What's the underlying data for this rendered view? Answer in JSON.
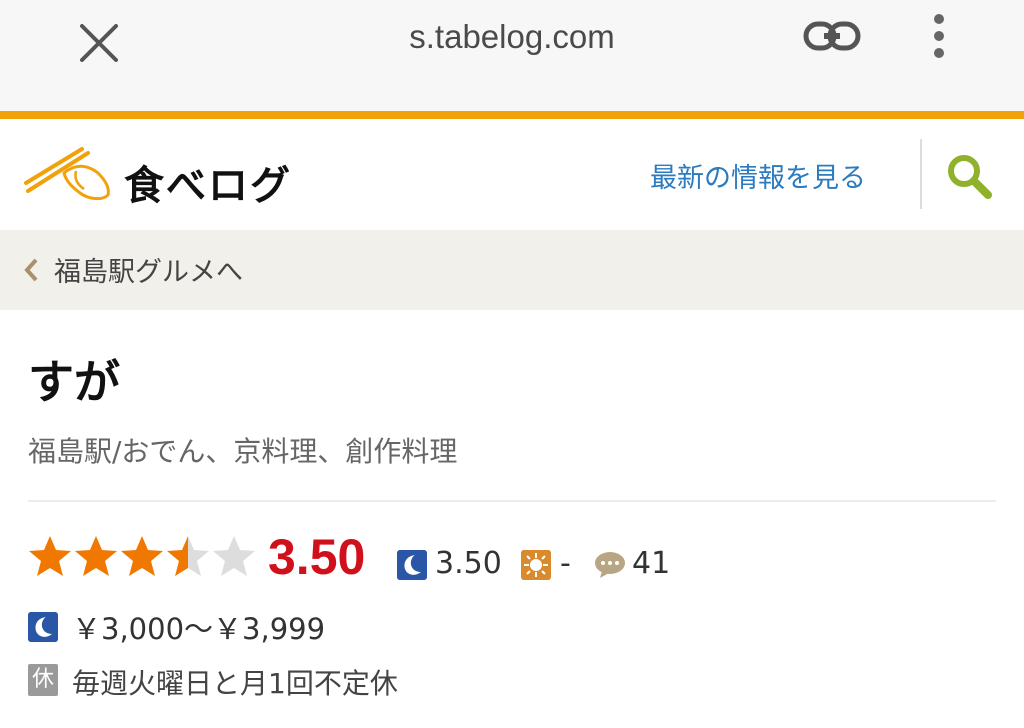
{
  "browser": {
    "url": "s.tabelog.com",
    "close_icon": "close-icon",
    "link_icon": "link-icon",
    "menu_icon": "more-vert-icon"
  },
  "header": {
    "logo_text": "食べログ",
    "latest_info_link": "最新の情報を見る",
    "search_icon": "search-icon"
  },
  "breadcrumb": {
    "label": "福島駅グルメへ"
  },
  "restaurant": {
    "name": "すが",
    "subtitle": "福島駅/おでん、京料理、創作料理",
    "rating": {
      "stars": 3.5,
      "score": "3.50",
      "dinner_score": "3.50",
      "lunch_score": "-",
      "review_count": "41"
    },
    "budget_dinner": "￥3,000～￥3,999",
    "holiday_badge": "休",
    "holiday_text": "毎週火曜日と月1回不定休"
  },
  "colors": {
    "accent": "#f1a20b",
    "link": "#2b7bc0",
    "score": "#d0111b",
    "star": "#f07800",
    "dinner_icon": "#2a56a8",
    "lunch_icon": "#d98a2c"
  }
}
